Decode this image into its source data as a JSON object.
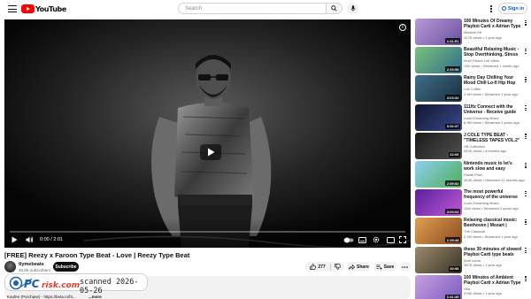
{
  "masthead": {
    "logo_text": "YouTube",
    "search_placeholder": "Search",
    "signin_label": "Sign in"
  },
  "player": {
    "time_display": "0:00 / 2:01",
    "progress_fraction": 0.0
  },
  "video": {
    "title": "[FREE] Reezy x Faroon Type Beat - Love | Reezy Type Beat",
    "channel": "tlymebeats",
    "subscribers": "30.6K subscribers",
    "subscribe_label": "Subscribe",
    "likes": "277",
    "share_label": "Share",
    "save_label": "Save",
    "description_line": "Kaufen (Purchase) - https://beta.ro/f4...",
    "more_label": "...more"
  },
  "watermark": {
    "text": "scanned 2026-05-26"
  },
  "sidebar": [
    {
      "title": "100 Minutes Of Dreamy Playboi Carti x Adrian Type Beats By ...",
      "channel": "Medium Kit",
      "meta": "327K views • 1 year ago",
      "duration": "1:41:51",
      "colors": [
        "#b79ad6",
        "#6a4fa0"
      ]
    },
    {
      "title": "Beautiful Relaxing Music - Stop Overthinking, Stress Relief ...",
      "channel": "Inner Peace Lofi Vibes",
      "meta": "13K views • Streamed 1 month ago",
      "duration": "2:33:58",
      "colors": [
        "#7bc37a",
        "#2f6b8a"
      ]
    },
    {
      "title": "Rainy Day Chilling Your Mood Chill Lo-fi Hip Hop to...",
      "channel": "Lofi Coffee",
      "meta": "3.4M views • Streamed 1 year ago",
      "duration": "3:03:32",
      "colors": [
        "#3f6f88",
        "#1a2f40"
      ]
    },
    {
      "title": "111Hz Connect with the Universe - Receive guide from ...",
      "channel": "Lucid Dreaming Music",
      "meta": "8.9M views • Streamed 2 years ago",
      "duration": "3:32:37",
      "colors": [
        "#101530",
        "#3a4a8a"
      ]
    },
    {
      "title": "J COLE TYPE BEAT - \"TIMELESS TAPES VOL.2\"",
      "channel": "SB Collective",
      "meta": "542K views • 8 months ago",
      "duration": "22:06",
      "colors": [
        "#1a1a1a",
        "#505050"
      ]
    },
    {
      "title": "Nintendo music to let's work slow and easy",
      "channel": "Pastel Pixel",
      "meta": "344K views • Streamed 11 months ago",
      "duration": "2:59:52",
      "colors": [
        "#8fcff0",
        "#4fae5a"
      ]
    },
    {
      "title": "The most powerful frequency of the universe 999 Hz - you will ...",
      "channel": "Lucid Dreaming Music",
      "meta": "14M views • Streamed 2 years ago",
      "duration": "3:00:03",
      "colors": [
        "#5b1f9c",
        "#c05ad6"
      ]
    },
    {
      "title": "Relaxing classical music: Beethoven | Mozart | Chopin | ...",
      "channel": "The Classical",
      "meta": "2.2M views • Streamed 1 year ago",
      "duration": "1:39:48",
      "colors": [
        "#e0a050",
        "#8a4a20"
      ]
    },
    {
      "title": "these 30 minutes of slowed Playboi Carti type beats will ...",
      "channel": "jinxti coma",
      "meta": "387K views • 1 year ago",
      "duration": "30:58",
      "colors": [
        "#9a8a6a",
        "#3a3326"
      ]
    },
    {
      "title": "100 Minutes of Ambient Playboi Carti x Adrian Type Beats By ...",
      "channel": "Vita",
      "meta": "478K views • 1 year ago",
      "duration": "1:41:35",
      "colors": [
        "#c8a0e0",
        "#7a5ac0"
      ]
    }
  ]
}
